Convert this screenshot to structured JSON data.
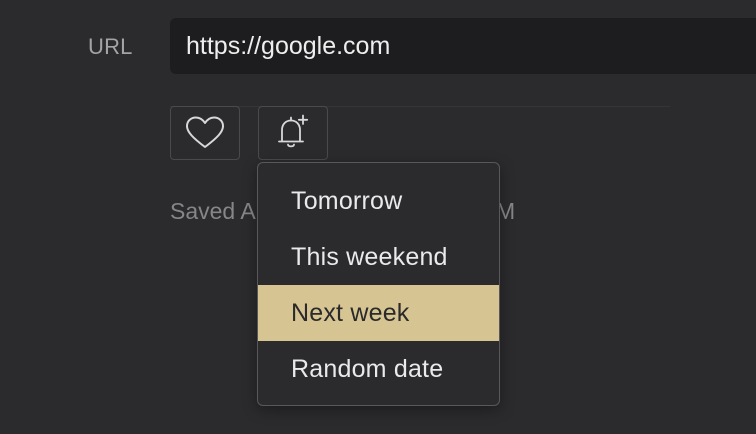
{
  "form": {
    "url_label": "URL",
    "url_value": "https://google.com"
  },
  "actions": {
    "favorite_icon": "heart-icon",
    "reminder_icon": "bell-plus-icon"
  },
  "status": {
    "saved_prefix": "Saved A",
    "saved_suffix": "M"
  },
  "reminder_menu": {
    "items": [
      {
        "label": "Tomorrow"
      },
      {
        "label": "This weekend"
      },
      {
        "label": "Next week",
        "highlighted": true
      },
      {
        "label": "Random date"
      }
    ],
    "highlight_color": "#d7c493"
  }
}
